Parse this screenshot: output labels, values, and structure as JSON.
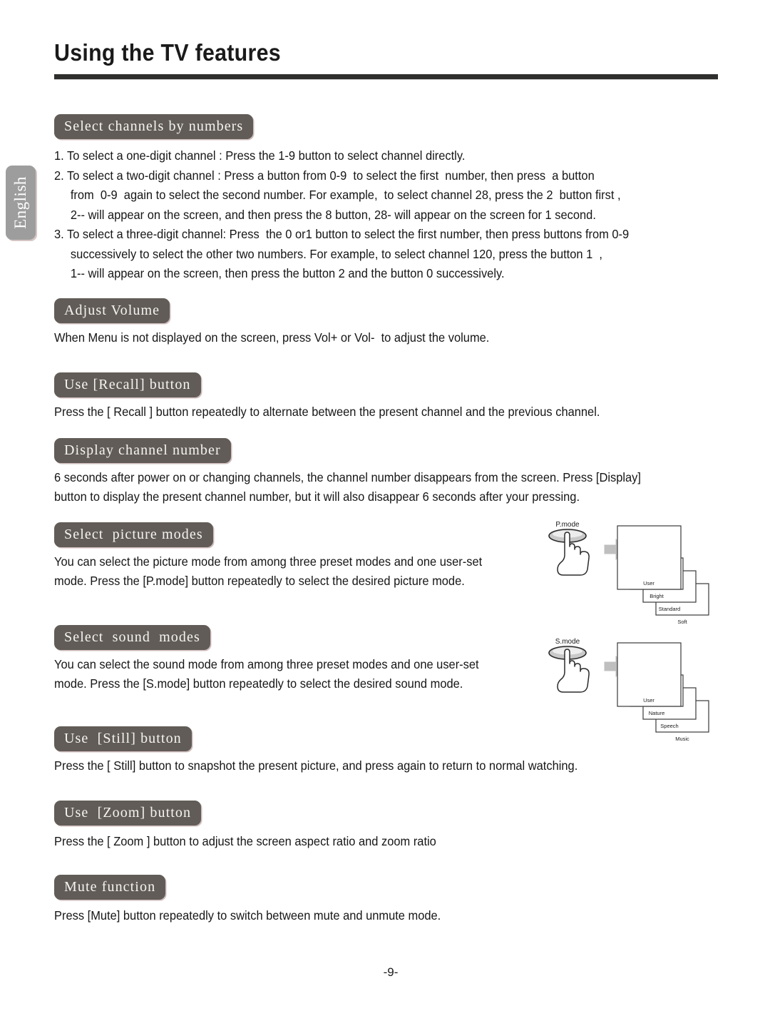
{
  "page": {
    "title": "Using the TV features",
    "language_tab": "English",
    "footer": "-9-",
    "badge_color": "#615c57",
    "rule_color": "#2f2f2d",
    "tab_color": "#9d9d9d"
  },
  "sections": {
    "channels": {
      "heading": "Select channels by numbers",
      "items": [
        "1. To select a one-digit channel : Press the 1-9 button to select channel directly.",
        "2. To select a two-digit channel : Press a button from 0-9  to select the first  number, then press  a button\n     from  0-9  again to select the second number. For example,  to select channel 28, press the 2  button first ,\n     2-- will appear on the screen, and then press the 8 button, 28- will appear on the screen for 1 second.",
        "3. To select a three-digit channel: Press  the 0 or1 button to select the first number, then press buttons from 0-9\n     successively to select the other two numbers. For example, to select channel 120, press the button 1  ,\n     1-- will appear on the screen, then press the button 2 and the button 0 successively."
      ]
    },
    "volume": {
      "heading": "Adjust Volume",
      "body": "When Menu is not displayed on the screen, press Vol+ or Vol-  to adjust the volume."
    },
    "recall": {
      "heading": "Use [Recall] button",
      "body": "Press the [ Recall ] button repeatedly to alternate between the present channel and the previous channel."
    },
    "display": {
      "heading": "Display channel number",
      "body": "6 seconds after power on or changing channels, the channel number disappears from the screen. Press [Display]\nbutton to display the present channel number, but it will also disappear 6 seconds after your pressing."
    },
    "picture": {
      "heading": "Select  picture modes",
      "body": "You can select the picture mode from among three preset modes and one user-set\nmode. Press the [P.mode] button repeatedly to select the desired picture mode.",
      "diagram": {
        "button_label": "P.mode",
        "screens": [
          "User",
          "Bright",
          "Standard",
          "Soft"
        ]
      }
    },
    "sound": {
      "heading": "Select  sound  modes",
      "body": "You can select the sound mode from among three preset modes and one user-set\nmode. Press the [S.mode] button repeatedly to select the desired sound mode.",
      "diagram": {
        "button_label": "S.mode",
        "screens": [
          "User",
          "Nature",
          "Speech",
          "Music"
        ]
      }
    },
    "still": {
      "heading": "Use  [Still] button",
      "body": "Press the [ Still] button to snapshot the present picture, and press again to return to normal watching."
    },
    "zoom": {
      "heading": "Use  [Zoom] button",
      "body": "Press the [ Zoom ] button to adjust the screen aspect ratio and zoom ratio"
    },
    "mute": {
      "heading": "Mute function",
      "body": "Press [Mute] button repeatedly to switch between mute and unmute mode."
    }
  }
}
